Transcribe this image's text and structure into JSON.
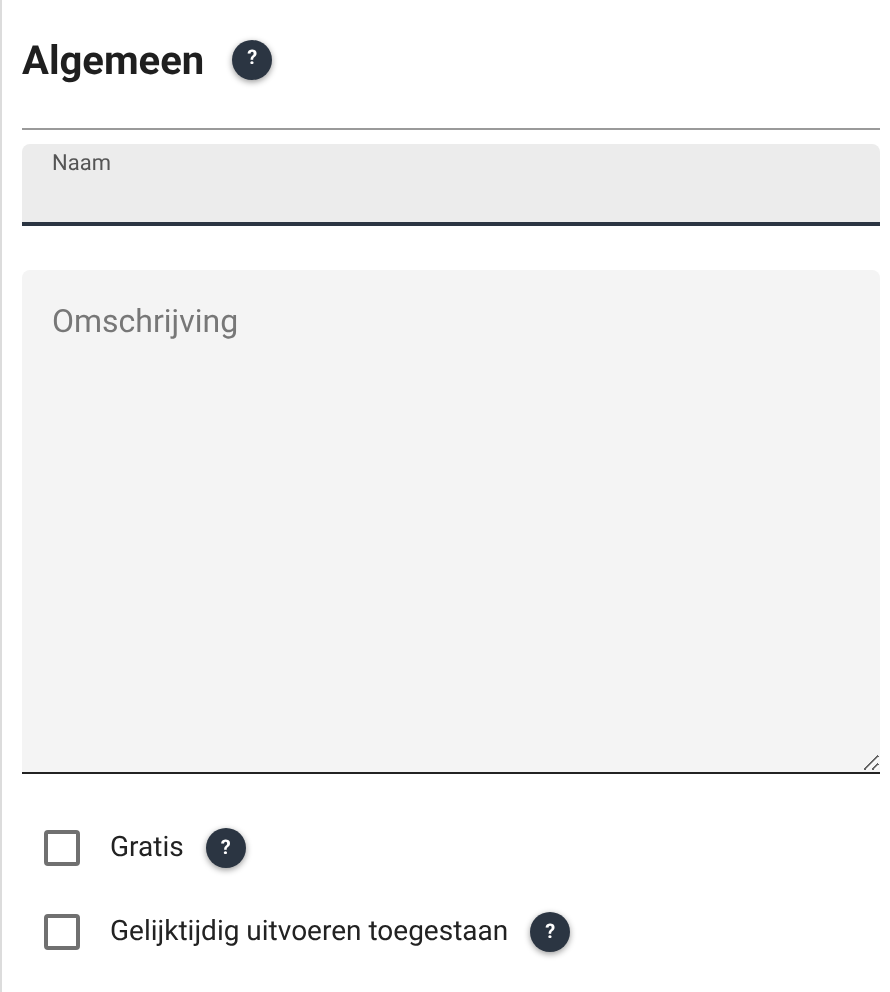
{
  "section": {
    "title": "Algemeen",
    "help": "?"
  },
  "name_field": {
    "label": "Naam"
  },
  "description_field": {
    "placeholder": "Omschrijving"
  },
  "options": [
    {
      "label": "Gratis",
      "checked": false,
      "help": "?"
    },
    {
      "label": "Gelijktijdig uitvoeren toegestaan",
      "checked": false,
      "help": "?"
    }
  ]
}
